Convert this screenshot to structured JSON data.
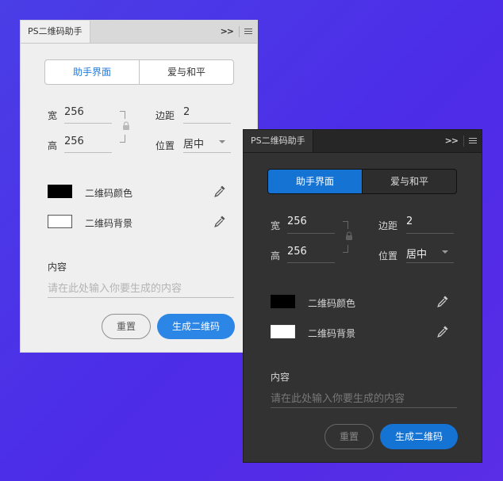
{
  "panels": {
    "light": {
      "tab_title": "PS二维码助手",
      "segmented": {
        "active_label": "助手界面",
        "inactive_label": "爱与和平"
      },
      "dims": {
        "width_label": "宽",
        "width_value": "256",
        "height_label": "高",
        "height_value": "256"
      },
      "margin": {
        "label": "边距",
        "value": "2"
      },
      "position": {
        "label": "位置",
        "value": "居中"
      },
      "colors": {
        "qr_color_label": "二维码颜色",
        "qr_bg_label": "二维码背景",
        "qr_color": "#000000",
        "qr_bg": "#ffffff"
      },
      "content": {
        "label": "内容",
        "placeholder": "请在此处输入你要生成的内容"
      },
      "buttons": {
        "reset": "重置",
        "generate": "生成二维码"
      }
    },
    "dark": {
      "tab_title": "PS二维码助手",
      "segmented": {
        "active_label": "助手界面",
        "inactive_label": "爱与和平"
      },
      "dims": {
        "width_label": "宽",
        "width_value": "256",
        "height_label": "高",
        "height_value": "256"
      },
      "margin": {
        "label": "边距",
        "value": "2"
      },
      "position": {
        "label": "位置",
        "value": "居中"
      },
      "colors": {
        "qr_color_label": "二维码颜色",
        "qr_bg_label": "二维码背景",
        "qr_color": "#000000",
        "qr_bg": "#ffffff"
      },
      "content": {
        "label": "内容",
        "placeholder": "请在此处输入你要生成的内容"
      },
      "buttons": {
        "reset": "重置",
        "generate": "生成二维码"
      }
    }
  },
  "theme": {
    "accent_light": "#2b86e6",
    "accent_dark": "#1573d4",
    "background": "#4d2ce8"
  },
  "icons": {
    "expand": "double-chevron-right-icon",
    "menu": "hamburger-menu-icon",
    "lock": "lock-icon",
    "eyedropper": "eyedropper-icon",
    "dropdown": "chevron-down-icon"
  }
}
